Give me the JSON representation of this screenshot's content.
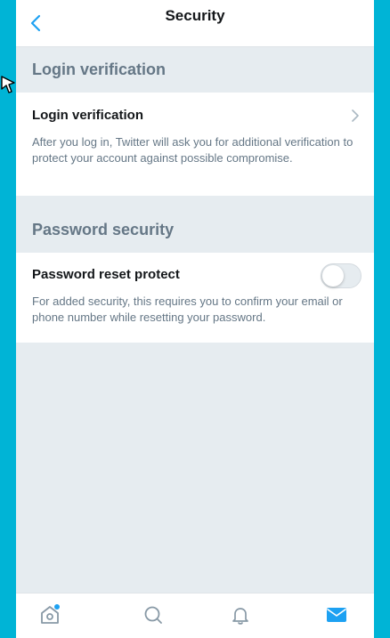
{
  "header": {
    "title": "Security",
    "subtitle": ""
  },
  "sections": [
    {
      "heading": "Login verification",
      "row_title": "Login verification",
      "row_description": "After you log in, Twitter will ask you for additional verification to protect your account against possible compromise."
    },
    {
      "heading": "Password security",
      "row_title": "Password reset protect",
      "row_description": "For added security, this requires you to confirm your email or phone number while resetting your password.",
      "toggle_on": false
    }
  ],
  "tabbar": {
    "items": [
      "home-icon",
      "search-icon",
      "notifications-icon",
      "messages-icon"
    ],
    "active": "messages-icon",
    "home_has_dot": true
  },
  "colors": {
    "accent": "#1da1f2",
    "background": "#e6ecf0",
    "frame_border": "#00b4d6",
    "secondary_text": "#657786"
  }
}
